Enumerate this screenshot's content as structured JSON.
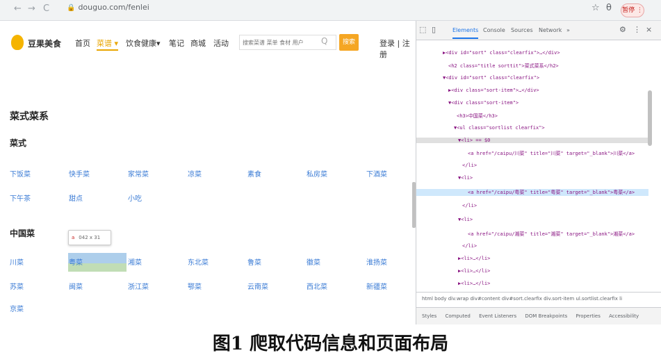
{
  "browser": {
    "back_icon": "←",
    "forward_icon": "→",
    "reload_icon": "C",
    "url": "douguo.com/fenlei",
    "star_icon": "☆",
    "profile_icon": "θ",
    "pause_label": "暂停 ⋮"
  },
  "site": {
    "logo_text": "豆果美食",
    "nav": [
      "首页",
      "菜谱 ▾",
      "饮食健康▾",
      "笔记",
      "商城",
      "活动"
    ],
    "search_placeholder": "搜索菜谱 菜单 食材 用户",
    "search_icon": "Q",
    "search_button": "搜索",
    "login": "登录 | 注册"
  },
  "main": {
    "section_title": "菜式菜系",
    "groups": [
      {
        "title": "菜式",
        "rows": [
          [
            "下饭菜",
            "快手菜",
            "家常菜",
            "凉菜",
            "素食",
            "私房菜",
            "下酒菜"
          ],
          [
            "下午茶",
            "甜点",
            "小吃"
          ]
        ]
      },
      {
        "title": "中国菜",
        "rows": [
          [
            "川菜",
            "粤菜",
            "湘菜",
            "东北菜",
            "鲁菜",
            "徽菜",
            "淮扬菜"
          ],
          [
            "苏菜",
            "闽菜",
            "浙江菜",
            "鄂菜",
            "云南菜",
            "西北菜",
            "新疆菜"
          ],
          [
            "京菜"
          ]
        ]
      }
    ],
    "tooltip_tag": "a",
    "tooltip_size": "042 x 31"
  },
  "devtools": {
    "tabs": [
      "Elements",
      "Console",
      "Sources",
      "Network",
      "»"
    ],
    "dom_lines": [
      "▶<div id=\"sort\" class=\"clearfix\">…</div>",
      "<h2 class=\"title sorttit\">菜式菜系</h2>",
      "▼<div id=\"sort\" class=\"clearfix\">",
      "▶<div class=\"sort-item\">…</div>",
      "▼<div class=\"sort-item\">",
      "<h3>中国菜</h3>",
      "▼<ul class=\"sortlist clearfix\">",
      "▼<li> == $0",
      "<a href=\"/caipu/川菜\" title=\"川菜\" target=\"_blank\">川菜</a>",
      "</li>",
      "▼<li>",
      "<a href=\"/caipu/粤菜\" title=\"粤菜\" target=\"_blank\">粤菜</a>",
      "</li>",
      "▼<li>",
      "<a href=\"/caipu/湘菜\" title=\"湘菜\" target=\"_blank\">湘菜</a>",
      "</li>",
      "▶<li>…</li>",
      "▶<li>…</li>",
      "▶<li>…</li>"
    ],
    "breadcrumb": "html  body  div.wrap  div#content  div#sort.clearfix  div.sort-item  ul.sortlist.clearfix  li",
    "subtabs": [
      "Styles",
      "Computed",
      "Event Listeners",
      "DOM Breakpoints",
      "Properties",
      "Accessibility"
    ]
  },
  "caption": "图1  爬取代码信息和页面布局"
}
